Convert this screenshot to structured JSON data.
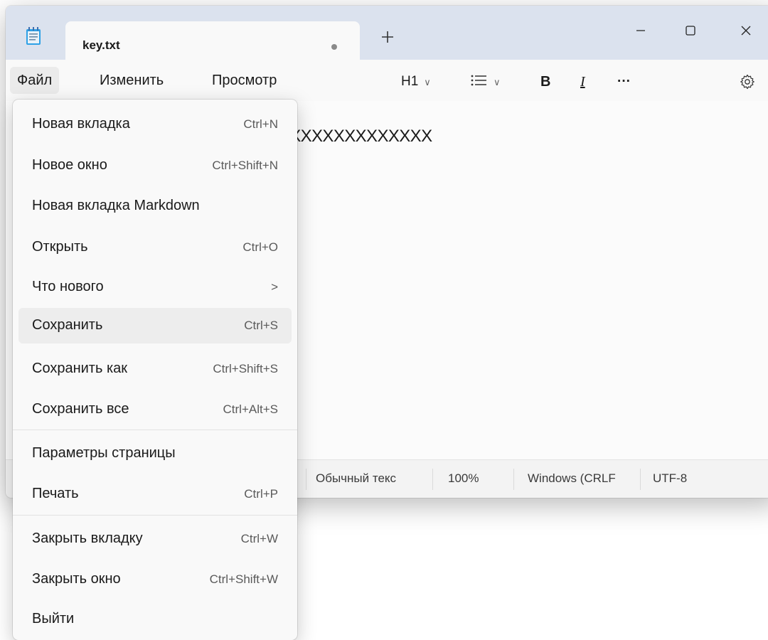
{
  "tab": {
    "title": "key.txt"
  },
  "window_buttons": {
    "minimize": "minimize-icon",
    "maximize": "maximize-icon",
    "close": "close-icon"
  },
  "menubar": {
    "file": "Файл",
    "edit": "Изменить",
    "view": "Просмотр"
  },
  "toolbar": {
    "heading": "H1",
    "list_icon": "list-icon",
    "bold": "B",
    "italic": "I",
    "more": "···",
    "settings_icon": "gear-icon"
  },
  "editor": {
    "text": "XXXXXXXXXXXXXXXXXXXXXXXXXXXXXXXXXXXXXX"
  },
  "status": {
    "format": "Обычный текс",
    "zoom": "100%",
    "line_ending": "Windows (CRLF",
    "encoding": "UTF-8"
  },
  "file_menu": {
    "items": [
      {
        "label": "Новая вкладка",
        "shortcut": "Ctrl+N"
      },
      {
        "label": "Новое окно",
        "shortcut": "Ctrl+Shift+N"
      },
      {
        "label": "Новая вкладка Markdown",
        "shortcut": ""
      },
      {
        "label": "Открыть",
        "shortcut": "Ctrl+O"
      },
      {
        "label": "Что нового",
        "shortcut": ">"
      },
      {
        "label": "Сохранить",
        "shortcut": "Ctrl+S"
      },
      {
        "label": "Сохранить как",
        "shortcut": "Ctrl+Shift+S"
      },
      {
        "label": "Сохранить все",
        "shortcut": "Ctrl+Alt+S"
      },
      {
        "label": "Параметры страницы",
        "shortcut": ""
      },
      {
        "label": "Печать",
        "shortcut": "Ctrl+P"
      },
      {
        "label": "Закрыть вкладку",
        "shortcut": "Ctrl+W"
      },
      {
        "label": "Закрыть окно",
        "shortcut": "Ctrl+Shift+W"
      },
      {
        "label": "Выйти",
        "shortcut": ""
      }
    ]
  },
  "colors": {
    "titlebar": "#dbe2ee",
    "menu_bg": "#f9f9f9",
    "hover": "#ededed"
  }
}
